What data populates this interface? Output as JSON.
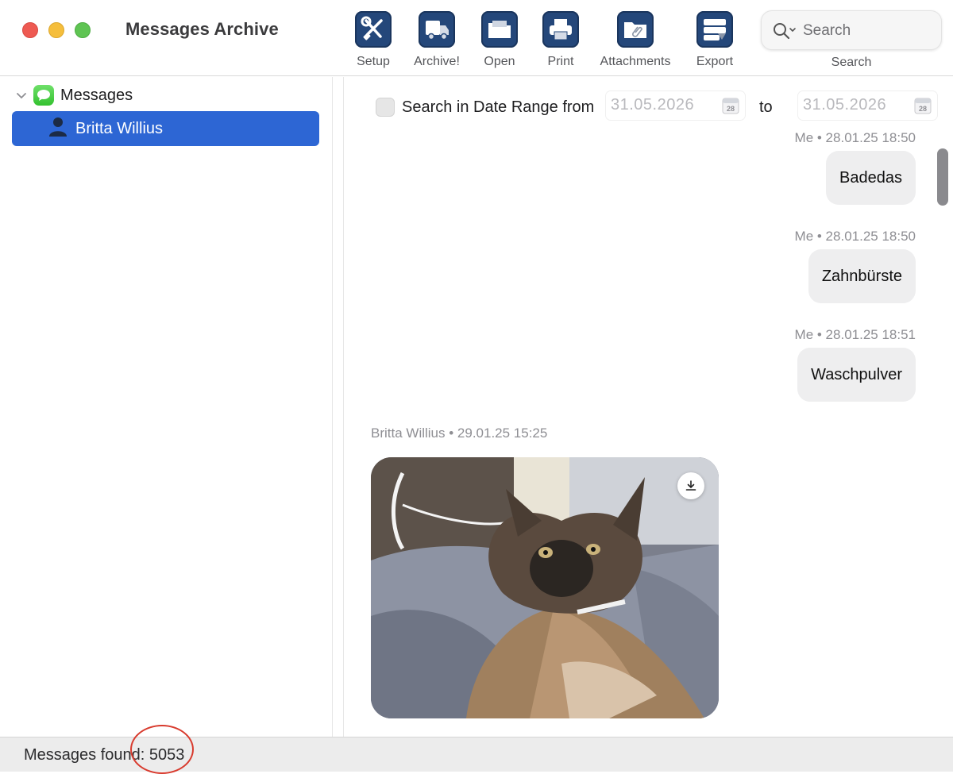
{
  "window": {
    "title": "Messages Archive"
  },
  "toolbar": {
    "buttons": [
      {
        "label": "Setup",
        "icon": "wrench-screwdriver-icon"
      },
      {
        "label": "Archive!",
        "icon": "truck-icon"
      },
      {
        "label": "Open",
        "icon": "folder-icon"
      },
      {
        "label": "Print",
        "icon": "printer-icon"
      },
      {
        "label": "Attachments",
        "icon": "paperclip-folder-icon"
      },
      {
        "label": "Export",
        "icon": "export-tray-icon"
      }
    ],
    "search": {
      "placeholder": "Search",
      "caption": "Search"
    },
    "accent_color": "#24477a"
  },
  "sidebar": {
    "group": {
      "label": "Messages"
    },
    "contacts": [
      {
        "name": "Britta Willius",
        "selected": true
      }
    ],
    "selection_color": "#2d66d4"
  },
  "main": {
    "date_filter": {
      "checkbox_label": "Search in Date Range from",
      "from": "31.05.2026",
      "to_label": "to",
      "to": "31.05.2026",
      "calendar_day": "28",
      "enabled": false
    },
    "messages": [
      {
        "meta": "Me • 28.01.25 18:50",
        "text": "Badedas"
      },
      {
        "meta": "Me • 28.01.25 18:50",
        "text": "Zahnbürste"
      },
      {
        "meta": "Me • 28.01.25 18:51",
        "text": "Waschpulver"
      },
      {
        "meta": "Britta Willius • 29.01.25 15:25",
        "attachment": "cat-photo"
      }
    ]
  },
  "status": {
    "text": "Messages found: 5053"
  }
}
